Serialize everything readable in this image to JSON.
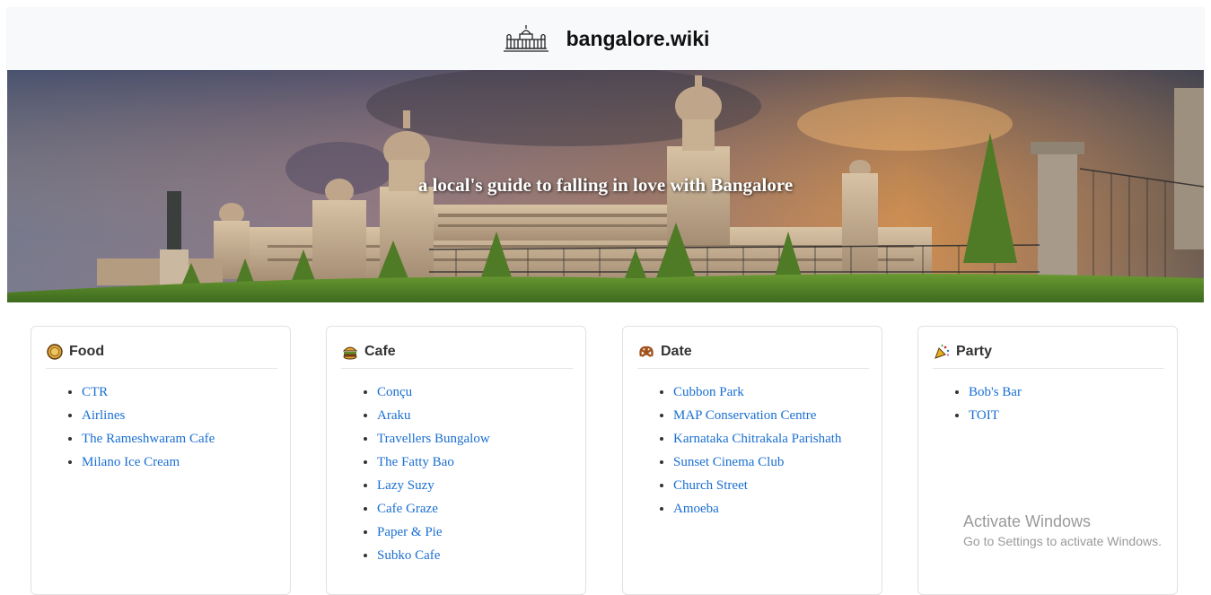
{
  "header": {
    "site_title": "bangalore.wiki",
    "logo_icon": "vidhana-soudha-icon"
  },
  "hero": {
    "tagline": "a local's guide to falling in love with Bangalore"
  },
  "categories": [
    {
      "icon": "food-icon",
      "title": "Food",
      "items": [
        "CTR",
        "Airlines",
        "The Rameshwaram Cafe",
        "Milano Ice Cream"
      ]
    },
    {
      "icon": "burger-icon",
      "title": "Cafe",
      "items": [
        "Conçu",
        "Araku",
        "Travellers Bungalow",
        "The Fatty Bao",
        "Lazy Suzy",
        "Cafe Graze",
        "Paper & Pie",
        "Subko Cafe"
      ]
    },
    {
      "icon": "pretzel-icon",
      "title": "Date",
      "items": [
        "Cubbon Park",
        "MAP Conservation Centre",
        "Karnataka Chitrakala Parishath",
        "Sunset Cinema Club",
        "Church Street",
        "Amoeba"
      ]
    },
    {
      "icon": "party-popper-icon",
      "title": "Party",
      "items": [
        "Bob's Bar",
        "TOIT"
      ]
    }
  ],
  "watermark": {
    "line1": "Activate Windows",
    "line2": "Go to Settings to activate Windows."
  },
  "colors": {
    "link": "#1a6fd1",
    "header_bg": "#f8f9fa"
  }
}
